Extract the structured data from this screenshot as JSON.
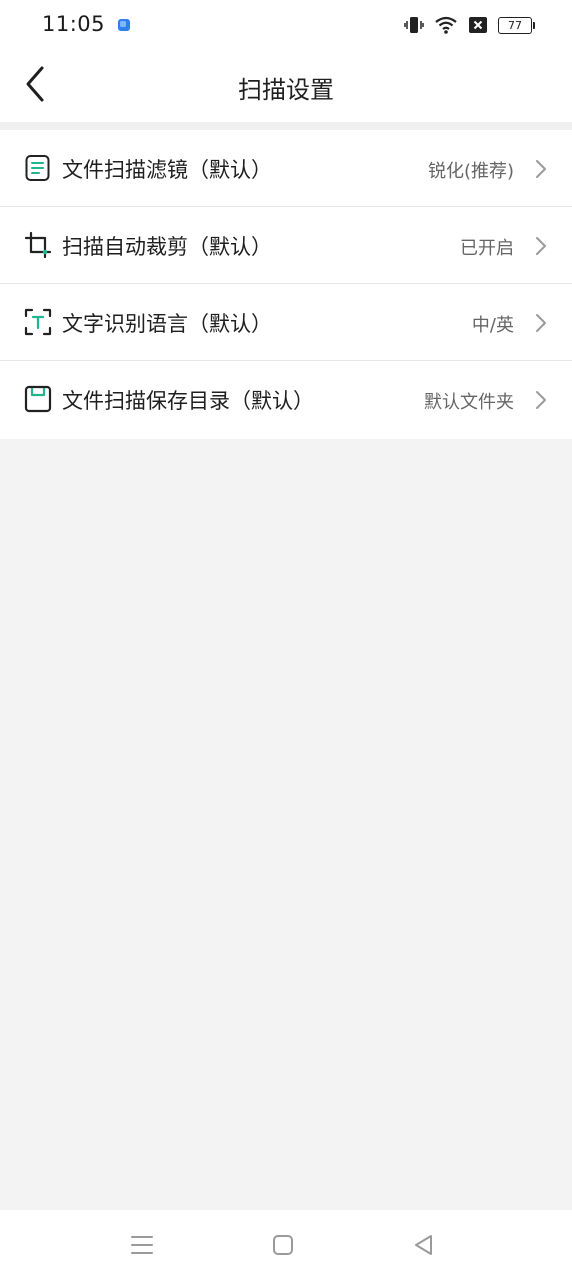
{
  "status_bar": {
    "time": "11:05",
    "battery_level": "77",
    "icons": [
      "app-notification-icon",
      "vibrate-icon",
      "wifi-icon",
      "sim-disabled-icon",
      "battery-icon"
    ]
  },
  "header": {
    "title": "扫描设置",
    "back_icon": "chevron-left-icon"
  },
  "settings": [
    {
      "icon": "document-filter-icon",
      "label": "文件扫描滤镜（默认）",
      "value": "锐化(推荐)"
    },
    {
      "icon": "crop-icon",
      "label": "扫描自动裁剪（默认）",
      "value": "已开启"
    },
    {
      "icon": "text-recognition-icon",
      "label": "文字识别语言（默认）",
      "value": "中/英"
    },
    {
      "icon": "save-folder-icon",
      "label": "文件扫描保存目录（默认）",
      "value": "默认文件夹"
    }
  ],
  "system_nav": {
    "buttons": [
      "menu-icon",
      "home-icon",
      "back-triangle-icon"
    ]
  },
  "colors": {
    "accent": "#1fb58f",
    "background": "#f3f3f3",
    "card": "#ffffff"
  }
}
